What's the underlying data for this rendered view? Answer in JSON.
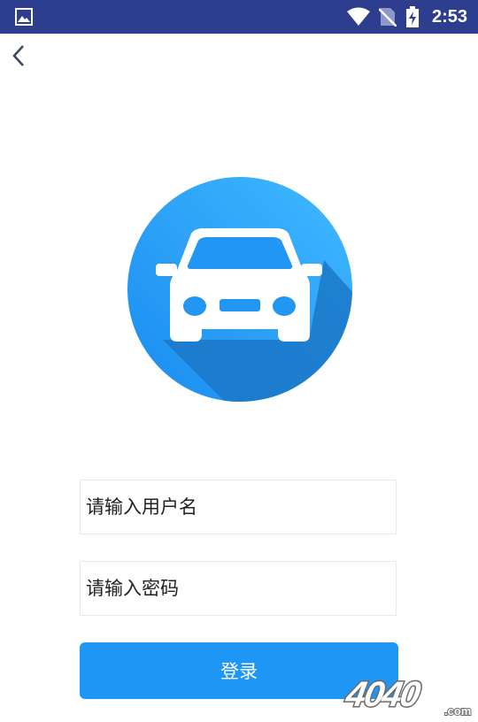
{
  "status_bar": {
    "time": "2:53",
    "icons": [
      "gallery-icon",
      "wifi-icon",
      "no-sim-icon",
      "battery-charging-icon"
    ],
    "background": "#2e3e8e"
  },
  "nav": {
    "back_icon": "chevron-left-icon"
  },
  "logo": {
    "icon": "car-icon",
    "circle_color": "#2196f3"
  },
  "form": {
    "username_placeholder": "请输入用户名",
    "password_placeholder": "请输入密码",
    "login_label": "登录"
  },
  "colors": {
    "accent": "#1e96f5"
  },
  "watermark": {
    "text": "4040",
    "suffix": ".com"
  }
}
